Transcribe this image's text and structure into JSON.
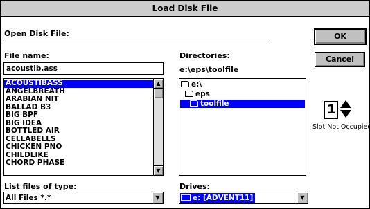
{
  "window": {
    "title": "Load Disk File"
  },
  "open_label": "Open Disk File:",
  "filename": {
    "label": "File name:",
    "value": "acoustib.ass"
  },
  "files": [
    "ACOUSTIBASS",
    "ANGELBREATH",
    "ARABIAN NIT",
    "BALLAD B3",
    "BIG BPF",
    "BIG IDEA",
    "BOTTLED AIR",
    "CELLABELLS",
    "CHICKEN PNO",
    "CHILDLIKE",
    "CHORD PHASE"
  ],
  "selected_file": "ACOUSTIBASS",
  "directories": {
    "label": "Directories:",
    "path": "e:\\eps\\toolfile",
    "tree": [
      "e:\\",
      "eps",
      "toolfile"
    ],
    "selected": "toolfile"
  },
  "buttons": {
    "ok": "OK",
    "cancel": "Cancel"
  },
  "slot": {
    "number": "1",
    "status": "Slot Not Occupied"
  },
  "filetype": {
    "label": "List files of type:",
    "value": "All Files *.*"
  },
  "drives": {
    "label": "Drives:",
    "value": "e: [ADVENT11]"
  },
  "icons": {
    "scroll_up": "▲",
    "scroll_down": "▼",
    "dropdown": "▼"
  }
}
